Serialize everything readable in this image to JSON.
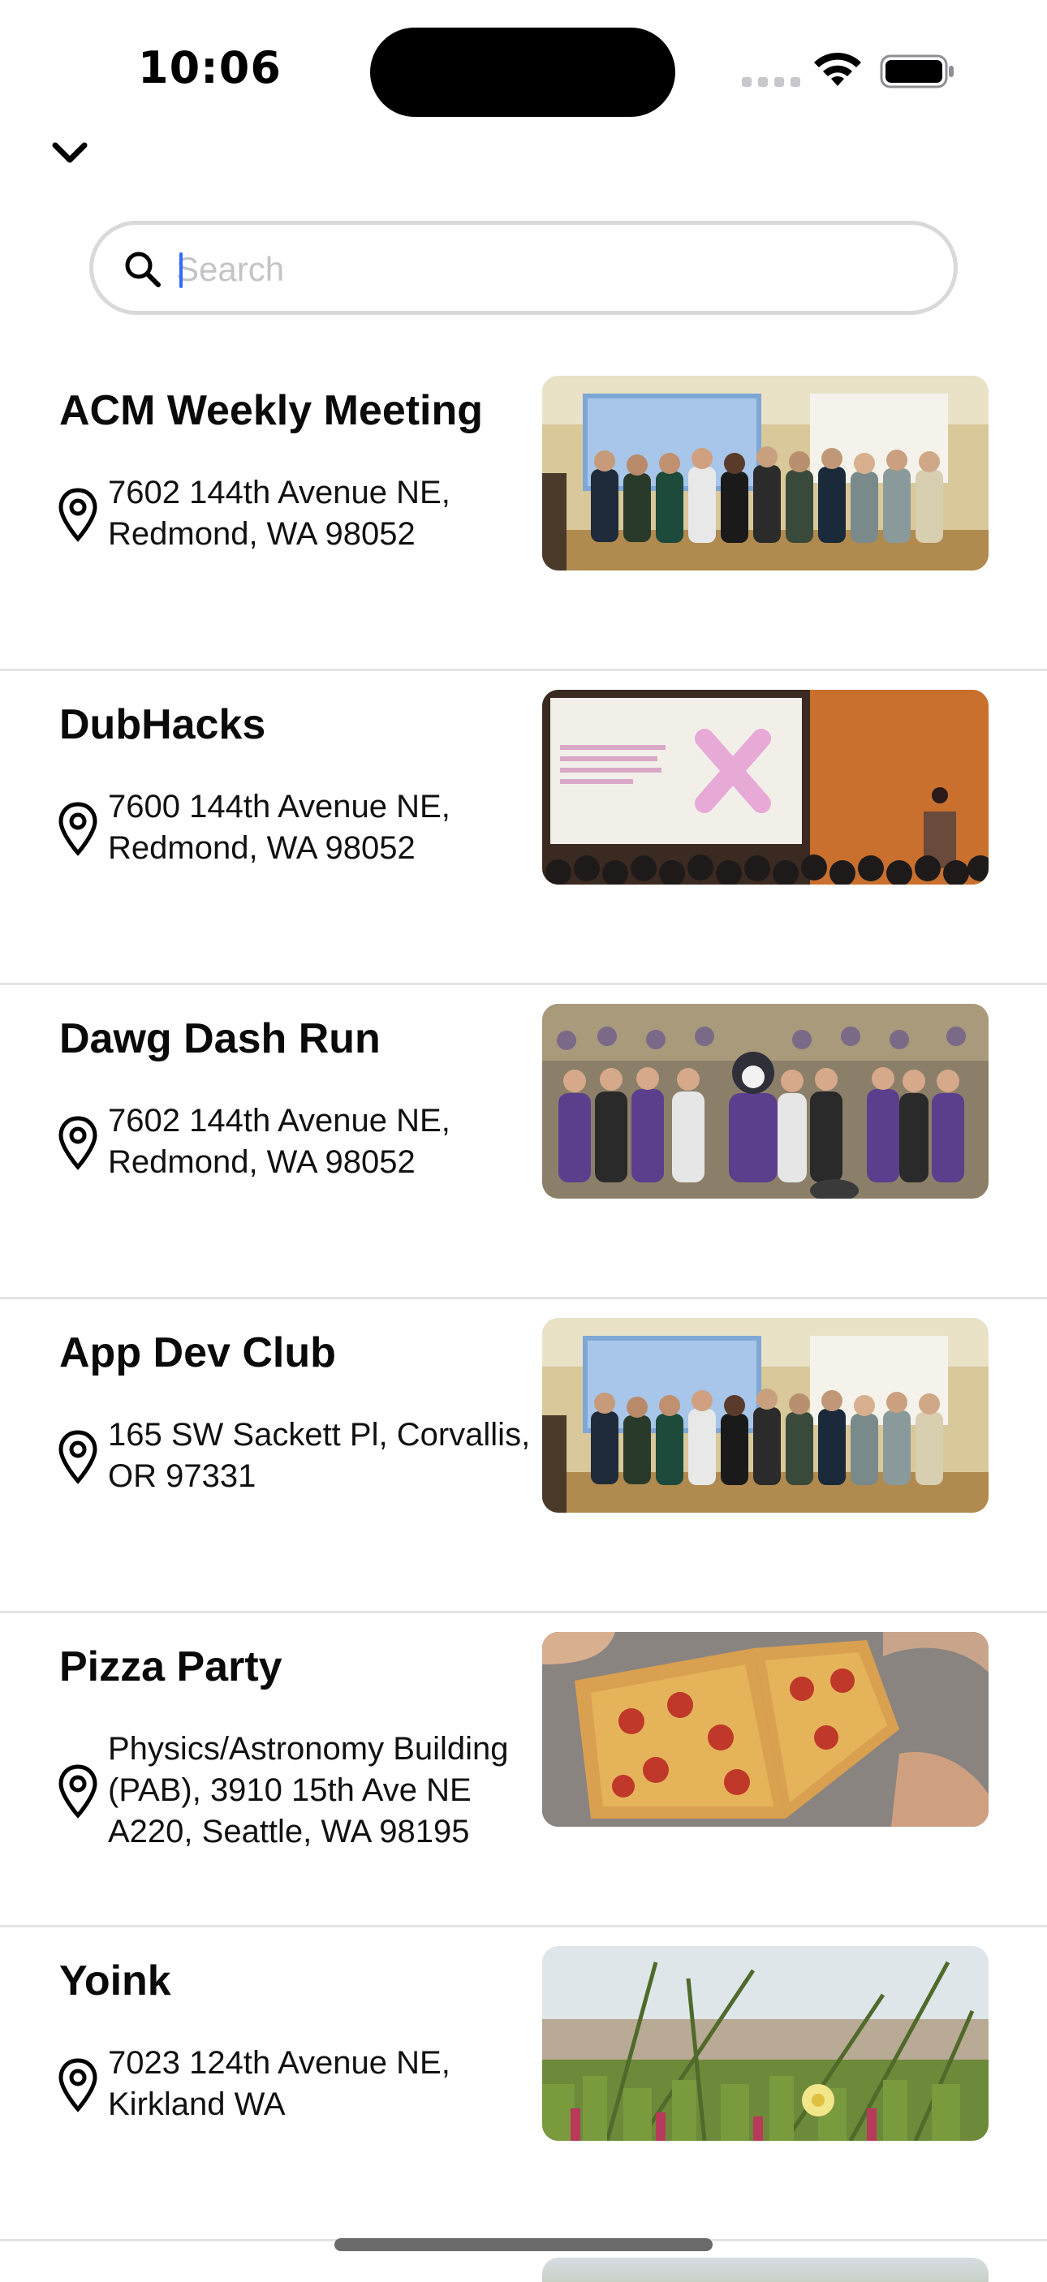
{
  "status_bar": {
    "time": "10:06"
  },
  "header": {
    "collapse_icon": "chevron-down-icon"
  },
  "search": {
    "placeholder": "Search",
    "value": "",
    "icon": "search-icon"
  },
  "events": [
    {
      "title": "ACM Weekly Meeting",
      "address": "7602 144th Avenue NE,\nRedmond, WA 98052",
      "image": "group-photo-lecture-hall"
    },
    {
      "title": "DubHacks",
      "address": "7600 144th Avenue NE,\nRedmond, WA 98052",
      "image": "presentation-audience"
    },
    {
      "title": "Dawg Dash Run",
      "address": "7602 144th Avenue NE,\nRedmond, WA 98052",
      "image": "crowd-runners-mascot"
    },
    {
      "title": "App Dev Club",
      "address": "165 SW Sackett Pl, Corvallis,\nOR 97331",
      "image": "group-photo-lecture-hall"
    },
    {
      "title": "Pizza Party",
      "address": "Physics/Astronomy Building\n(PAB), 3910 15th Ave NE\nA220, Seattle, WA 98195",
      "image": "pizza-on-table"
    },
    {
      "title": "Yoink",
      "address": "7023 124th Avenue NE,\nKirkland WA",
      "image": "coastal-plants"
    }
  ],
  "colors": {
    "accent_caret": "#2f6bff",
    "divider": "#e3e3e6",
    "search_border": "#d9d9d9",
    "placeholder": "#c4c4c6"
  }
}
